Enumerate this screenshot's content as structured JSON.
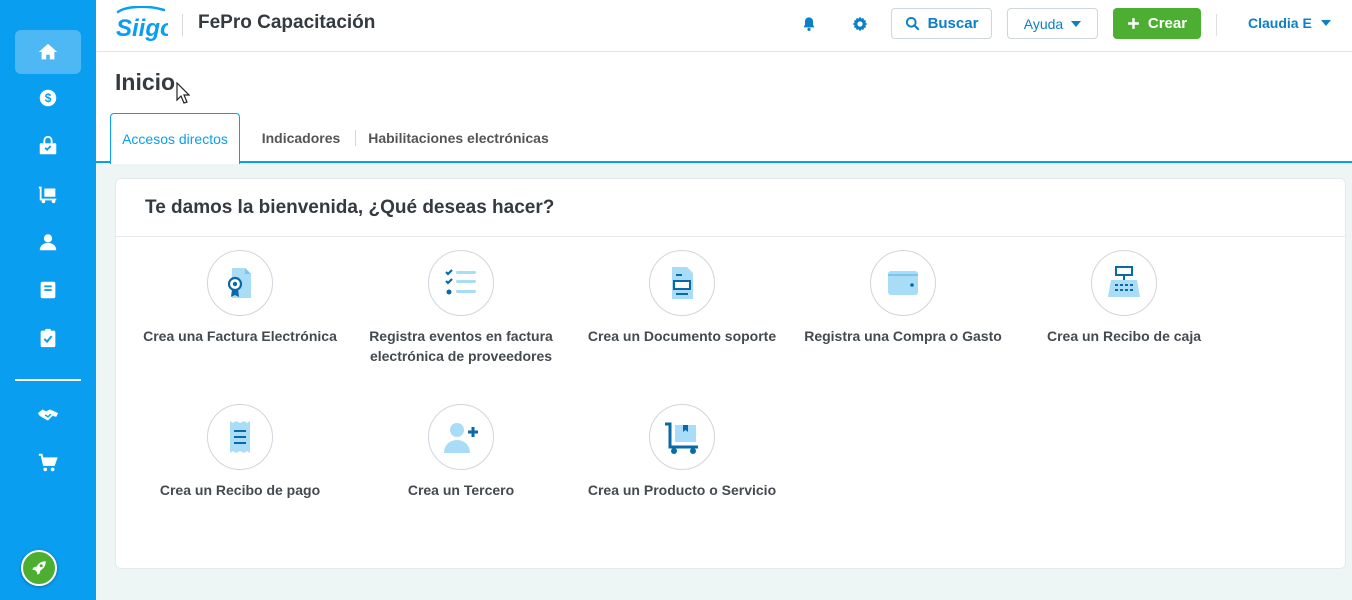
{
  "brand": {
    "logo_text": "Siigo",
    "primary": "#0a9ef0",
    "success": "#4caf32"
  },
  "header": {
    "company": "FePro Capacitación",
    "search_label": "Buscar",
    "help_label": "Ayuda",
    "create_label": "Crear",
    "user_name": "Claudia E"
  },
  "sidebar": {
    "items": [
      {
        "icon": "home-icon",
        "active": true
      },
      {
        "icon": "dollar-icon"
      },
      {
        "icon": "shopping-bag-icon"
      },
      {
        "icon": "cart-dolly-icon"
      },
      {
        "icon": "user-icon"
      },
      {
        "icon": "book-icon"
      },
      {
        "icon": "clipboard-check-icon"
      },
      {
        "icon": "handshake-icon"
      },
      {
        "icon": "shopping-cart-icon"
      }
    ],
    "footer_icon": "rocket-icon"
  },
  "page": {
    "title": "Inicio",
    "tabs": [
      {
        "label": "Accesos directos",
        "active": true
      },
      {
        "label": "Indicadores"
      },
      {
        "label": "Habilitaciones electrónicas"
      }
    ]
  },
  "welcome": {
    "title": "Te damos la bienvenida, ¿Qué deseas hacer?",
    "actions": [
      {
        "icon": "invoice-certificate-icon",
        "label": "Crea una Factura Electrónica"
      },
      {
        "icon": "checklist-icon",
        "label": "Registra eventos en factura electrónica de proveedores"
      },
      {
        "icon": "support-document-icon",
        "label": "Crea un Documento soporte"
      },
      {
        "icon": "wallet-icon",
        "label": "Registra una Compra o Gasto"
      },
      {
        "icon": "cash-register-icon",
        "label": "Crea un Recibo de caja"
      },
      {
        "icon": "payment-receipt-icon",
        "label": "Crea un Recibo de pago"
      },
      {
        "icon": "add-user-icon",
        "label": "Crea un Tercero"
      },
      {
        "icon": "product-cart-icon",
        "label": "Crea un Producto o Servicio"
      }
    ]
  }
}
